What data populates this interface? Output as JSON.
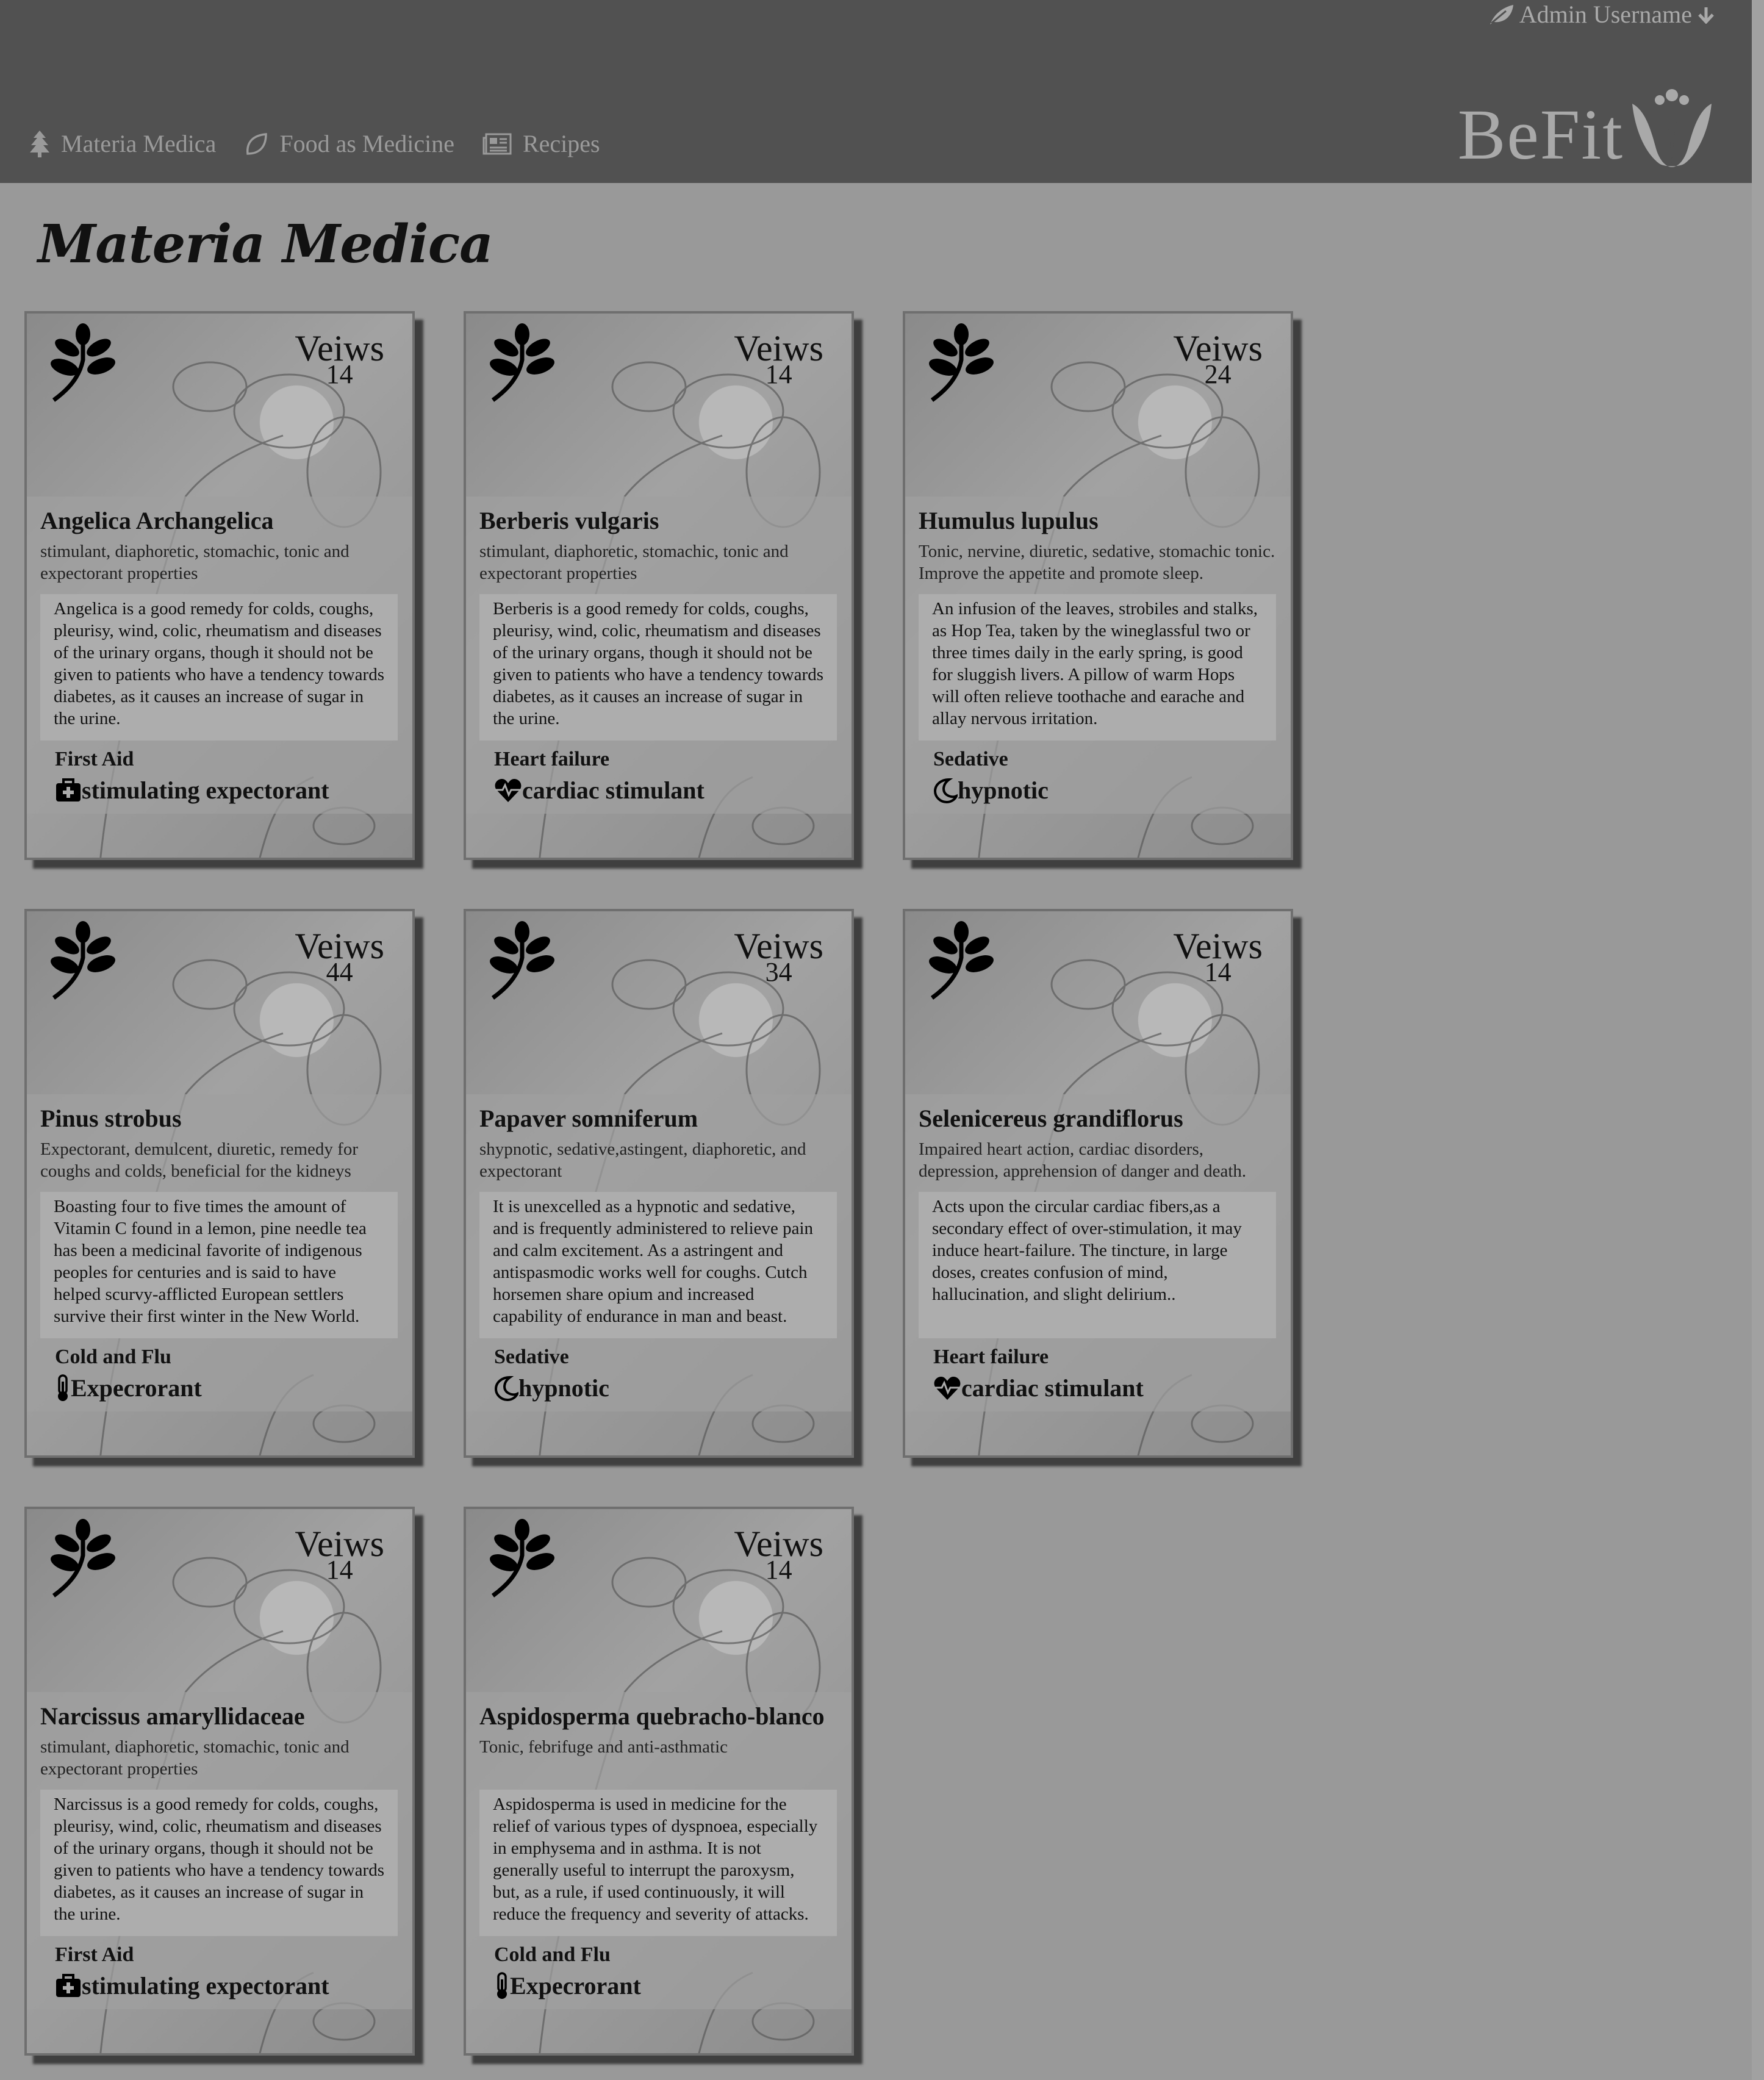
{
  "header": {
    "admin_label": "Admin Username",
    "logo": "BeFit",
    "nav": [
      {
        "label": "Materia Medica",
        "icon": "tree-icon"
      },
      {
        "label": "Food as Medicine",
        "icon": "leaf-outline-icon"
      },
      {
        "label": "Recipes",
        "icon": "newspaper-icon"
      }
    ]
  },
  "page_title": "Materia Medica",
  "views_label": "Veiws",
  "cards": [
    {
      "name": "Angelica Archangelica",
      "views": "14",
      "properties": "stimulant, diaphoretic, stomachic, tonic and expectorant properties",
      "description": "Angelica is a good remedy for colds, coughs, pleurisy, wind, colic, rheumatism and diseases of the urinary organs, though it should not be given to patients who have a tendency towards diabetes, as it causes an increase of sugar in the urine.",
      "condition": "First Aid",
      "action": "stimulating expectorant",
      "action_icon": "first-aid-kit-icon"
    },
    {
      "name": "Berberis vulgaris",
      "views": "14",
      "properties": "stimulant, diaphoretic, stomachic, tonic and expectorant properties",
      "description": "Berberis is a good remedy for colds, coughs, pleurisy, wind, colic, rheumatism and diseases of the urinary organs, though it should not be given to patients who have a tendency towards diabetes, as it causes an increase of sugar in the urine.",
      "condition": "Heart failure",
      "action": "cardiac stimulant",
      "action_icon": "heartbeat-icon"
    },
    {
      "name": "Humulus lupulus",
      "views": "24",
      "properties": "Tonic, nervine, diuretic, sedative, stomachic tonic. Improve the appetite and promote sleep.",
      "description": "An infusion of the leaves, strobiles and stalks, as Hop Tea, taken by the wineglassful two or three times daily in the early spring, is good for sluggish livers. A pillow of warm Hops will often relieve toothache and earache and allay nervous irritation.",
      "condition": "Sedative",
      "action": "hypnotic",
      "action_icon": "moon-icon"
    },
    {
      "name": "Pinus strobus",
      "views": "44",
      "properties": "Expectorant, demulcent, diuretic, remedy for coughs and colds, beneficial for the kidneys",
      "description": "Boasting four to five times the amount of Vitamin C found in a lemon, pine needle tea has been a medicinal favorite of indigenous peoples for centuries and is said to have helped scurvy-afflicted European settlers survive their first winter in the New World.",
      "condition": "Cold and Flu",
      "action": "Expecrorant",
      "action_icon": "thermometer-icon"
    },
    {
      "name": "Papaver somniferum",
      "views": "34",
      "properties": "shypnotic, sedative,astingent, diaphoretic, and expectorant",
      "description": "It is unexcelled as a hypnotic and sedative, and is frequently administered to relieve pain and calm excitement. As a astringent and antispasmodic works well for coughs. Cutch horsemen share opium and increased capability of endurance in man and beast.",
      "condition": "Sedative",
      "action": "hypnotic",
      "action_icon": "moon-icon"
    },
    {
      "name": "Selenicereus grandiflorus",
      "views": "14",
      "properties": "Impaired heart action, cardiac disorders, depression, apprehension of danger and death.",
      "description": "Acts upon the circular cardiac fibers,as a secondary effect of over-stimulation, it may induce heart-failure. The tincture, in large doses, creates confusion of mind, hallucination, and slight delirium..",
      "condition": "Heart failure",
      "action": "cardiac stimulant",
      "action_icon": "heartbeat-icon"
    },
    {
      "name": "Narcissus amaryllidaceae",
      "views": "14",
      "properties": "stimulant, diaphoretic, stomachic, tonic and expectorant properties",
      "description": "Narcissus is a good remedy for colds, coughs, pleurisy, wind, colic, rheumatism and diseases of the urinary organs, though it should not be given to patients who have a tendency towards diabetes, as it causes an increase of sugar in the urine.",
      "condition": "First Aid",
      "action": "stimulating expectorant",
      "action_icon": "first-aid-kit-icon"
    },
    {
      "name": "Aspidosperma quebracho-blanco",
      "views": "14",
      "properties": "Tonic, febrifuge and anti-asthmatic",
      "description": "Aspidosperma is used in medicine for the relief of various types of dyspnoea, especially in emphysema and in asthma. It is not generally useful to interrupt the paroxysm, but, as a rule, if used continuously, it will reduce the frequency and severity of attacks.",
      "condition": "Cold and Flu",
      "action": "Expecrorant",
      "action_icon": "thermometer-icon"
    }
  ]
}
